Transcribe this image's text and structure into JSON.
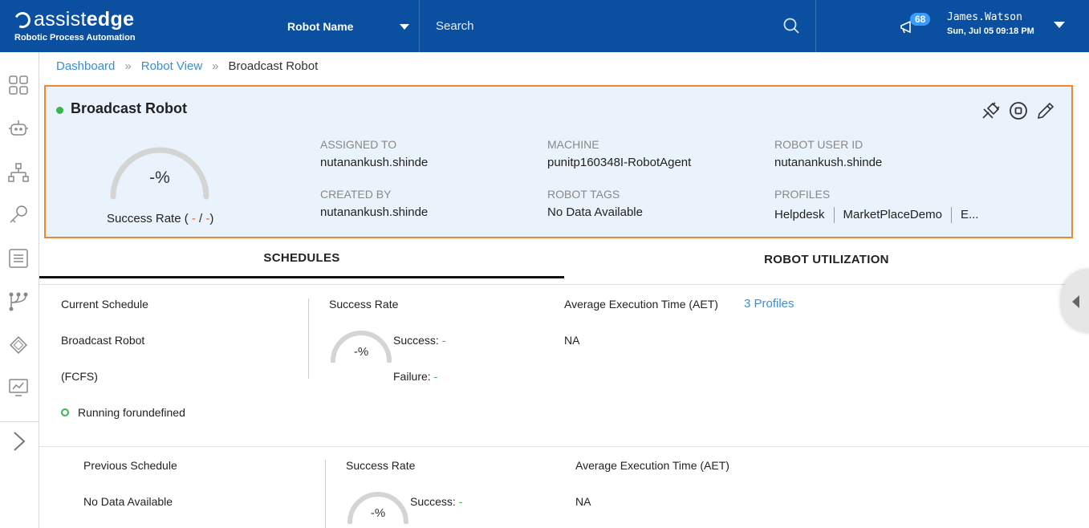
{
  "header": {
    "brand_prefix": "assist",
    "brand_suffix": "edge",
    "tagline": "Robotic Process Automation",
    "robot_select": "Robot Name",
    "search_placeholder": "Search",
    "notifications": "68",
    "user_name": "James.Watson",
    "user_date": "Sun, Jul 05 09:18 PM",
    "color": "#0b50a0"
  },
  "breadcrumb": {
    "items": [
      "Dashboard",
      "Robot View",
      "Broadcast Robot"
    ],
    "separator": "»"
  },
  "robot": {
    "name": "Broadcast Robot",
    "status_color": "#3bb54a",
    "gauge_value": "-%",
    "success_rate_prefix": "Success Rate ( ",
    "success_rate_a": "-",
    "success_rate_mid": " / ",
    "success_rate_b": "-",
    "success_rate_suffix": ")",
    "fields": {
      "assigned_to_label": "ASSIGNED TO",
      "assigned_to": "nutanankush.shinde",
      "created_by_label": "CREATED BY",
      "created_by": "nutanankush.shinde",
      "machine_label": "MACHINE",
      "machine": "punitp160348I-RobotAgent",
      "robot_tags_label": "ROBOT TAGS",
      "robot_tags": "No Data Available",
      "robot_user_id_label": "ROBOT USER ID",
      "robot_user_id": "nutanankush.shinde",
      "profiles_label": "PROFILES",
      "profiles": [
        "Helpdesk",
        "MarketPlaceDemo",
        "E..."
      ]
    },
    "highlight_color": "#f0862e"
  },
  "tabs": [
    {
      "label": "SCHEDULES",
      "active": true
    },
    {
      "label": "ROBOT UTILIZATION",
      "active": false
    }
  ],
  "current_schedule": {
    "label": "Current Schedule",
    "name": "Broadcast Robot",
    "mode": "(FCFS)",
    "running": "Running forundefined",
    "success_rate_label": "Success Rate",
    "gauge_value": "-%",
    "success_label": "Success:",
    "success_value": "-",
    "failure_label": "Failure:",
    "failure_value": "-",
    "aet_label": "Average Execution Time (AET)",
    "aet_value": "NA",
    "profiles_link": "3 Profiles"
  },
  "previous_schedule": {
    "label": "Previous Schedule",
    "name": "No Data Available",
    "success_rate_label": "Success Rate",
    "gauge_value": "-%",
    "success_label": "Success:",
    "success_value": "-",
    "aet_label": "Average Execution Time (AET)",
    "aet_value": "NA"
  }
}
